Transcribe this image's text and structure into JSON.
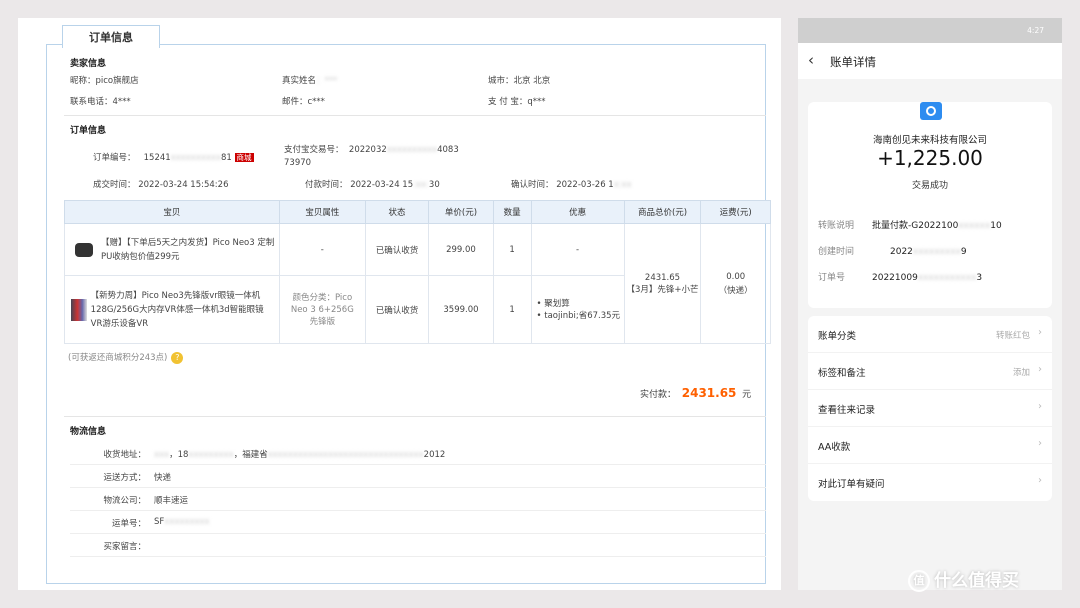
{
  "tab": "订单信息",
  "seller": {
    "title": "卖家信息",
    "nick": "昵称：pico旗舰店",
    "realname": "真实姓名",
    "city": "城市：北京 北京",
    "phone": "联系电话：4***",
    "email": "邮件：c***",
    "alipay": "支 付 宝：q***"
  },
  "order": {
    "title": "订单信息",
    "no_label": "订单编号：",
    "no_value": "15241",
    "no_tail": "81",
    "no_badge": "商城",
    "alipay_label": "支付宝交易号：",
    "alipay_value": "2022032",
    "alipay_tail": "4083",
    "alipay_line2": "73970",
    "deal_time": "成交时间：  2022-03-24 15:54:26",
    "pay_time": "付款时间：  2022-03-24 15",
    "pay_tail": "30",
    "confirm_time": "确认时间：  2022-03-26 1"
  },
  "table": {
    "headers": [
      "宝贝",
      "宝贝属性",
      "状态",
      "单价(元)",
      "数量",
      "优惠",
      "商品总价(元)",
      "运费(元)"
    ],
    "rows": [
      {
        "name": "【赠】【下单后5天之内发货】Pico Neo3 定制PU收纳包价值299元",
        "attr": "-",
        "status": "已确认收货",
        "price": "299.00",
        "qty": "1",
        "discount": "-"
      },
      {
        "name": "【新势力周】Pico Neo3先锋版vr眼镜一体机128G/256G大内存VR体感一体机3d智能眼镜VR游乐设备VR",
        "attr": "颜色分类：Pico Neo 3 6+256G 先锋版",
        "status": "已确认收货",
        "price": "3599.00",
        "qty": "1",
        "discount1": "• 聚划算",
        "discount2": "• taojinbi;省67.35元"
      }
    ],
    "total": "2431.65",
    "total_note": "【3月】先锋+小芒",
    "shipping": "0.00",
    "shipping_note": "（快递）"
  },
  "remark": "(可获返还商城积分243点)",
  "paid": {
    "label": "实付款：",
    "amount": "2431.65",
    "unit": "元"
  },
  "logistics": {
    "title": "物流信息",
    "rows": [
      {
        "label": "收货地址：",
        "value": "，18",
        "value2": "，福建省",
        "value3": "2012"
      },
      {
        "label": "运送方式：",
        "value": "快递"
      },
      {
        "label": "物流公司：",
        "value": "顺丰速运"
      },
      {
        "label": "运单号：",
        "value": "SF"
      },
      {
        "label": "买家留言：",
        "value": ""
      }
    ]
  },
  "phone": {
    "status_time": "4:27",
    "nav_title": "账单详情",
    "merchant": "海南创见未来科技有限公司",
    "amount": "+1,225.00",
    "result": "交易成功",
    "details": [
      {
        "k": "转账说明",
        "v": "批量付款-G2022100",
        "tail": "10"
      },
      {
        "k": "创建时间",
        "v": "2022",
        "tail": "9"
      },
      {
        "k": "订单号",
        "v": "20221009",
        "tail": "3"
      }
    ],
    "menu": [
      {
        "label": "账单分类",
        "value": "转账红包"
      },
      {
        "label": "标签和备注",
        "value": "添加"
      },
      {
        "label": "查看往来记录",
        "value": ""
      },
      {
        "label": "AA收款",
        "value": ""
      },
      {
        "label": "对此订单有疑问",
        "value": ""
      }
    ]
  },
  "watermark": "什么值得买",
  "colors": {
    "accent_orange": "#ff6000",
    "link_blue": "#2a6fc4",
    "header_bg": "#e9f1fa"
  }
}
